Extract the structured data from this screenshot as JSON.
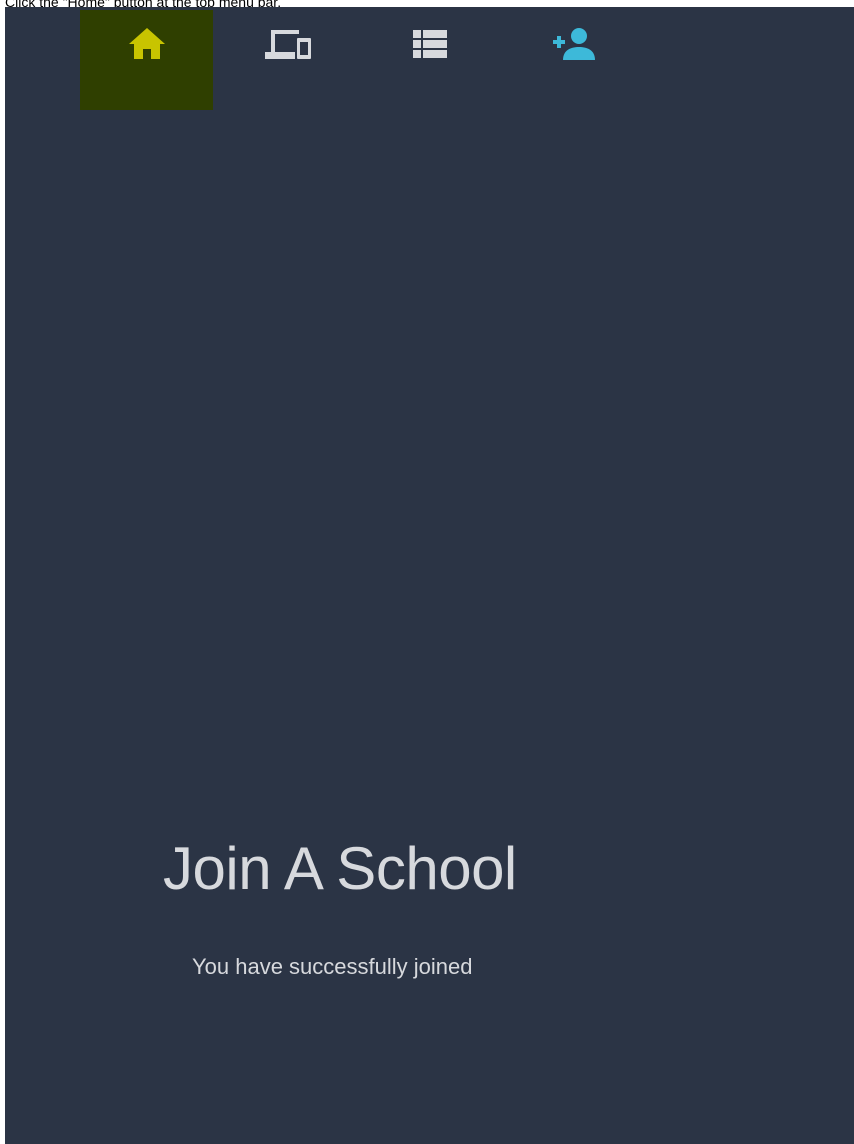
{
  "instruction": "Click the \"Home\" button at the top menu bar.",
  "nav": {
    "items": [
      {
        "icon": "home-icon",
        "color": "#c8c400",
        "active": true
      },
      {
        "icon": "devices-icon",
        "color": "#d7d9dd",
        "active": false
      },
      {
        "icon": "list-icon",
        "color": "#d7d9dd",
        "active": false
      },
      {
        "icon": "add-person-icon",
        "color": "#3db9d9",
        "active": false
      }
    ],
    "active_background": "#2f3f00"
  },
  "main": {
    "title": "Join A School",
    "message": "You have successfully joined"
  },
  "colors": {
    "background": "#2b3445",
    "text": "#d7d9dd"
  }
}
